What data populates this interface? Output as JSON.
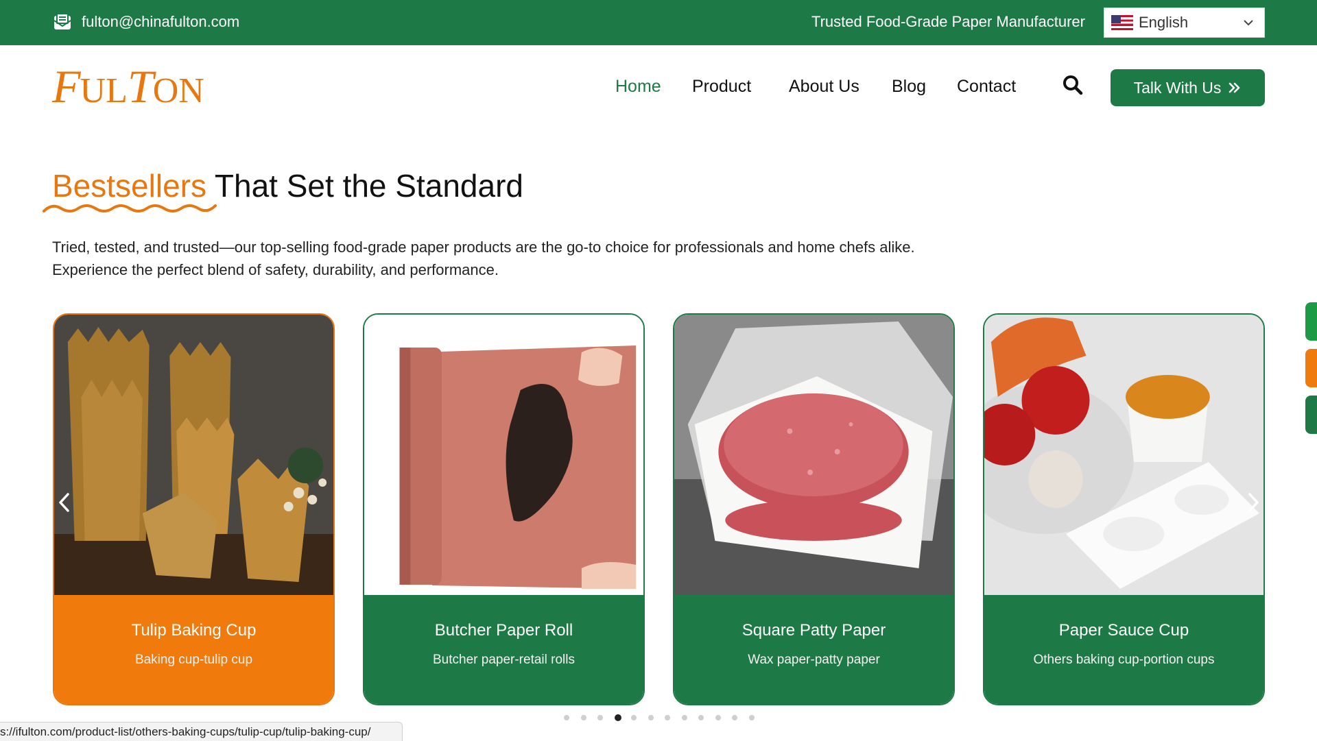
{
  "topbar": {
    "email": "fulton@chinafulton.com",
    "email_icon": "mail-icon",
    "tagline": "Trusted Food-Grade Paper Manufacturer",
    "language": "English",
    "language_flag": "us-flag-icon"
  },
  "header": {
    "logo_text": "FULTON",
    "nav": [
      {
        "label": "Home",
        "active": true
      },
      {
        "label": "Product",
        "active": false
      },
      {
        "label": "About Us",
        "active": false
      },
      {
        "label": "Blog",
        "active": false
      },
      {
        "label": "Contact",
        "active": false
      }
    ],
    "search_icon": "search-icon",
    "cta_label": "Talk With Us",
    "cta_icon": "double-chevron-right-icon"
  },
  "section": {
    "heading_accent": "Bestsellers",
    "heading_rest": "That Set the Standard",
    "intro": "Tried, tested, and trusted—our top-selling food-grade paper products are the go-to choice for professionals and home chefs alike. Experience the perfect blend of safety, durability, and performance."
  },
  "products": [
    {
      "title": "Tulip Baking Cup",
      "subtitle": "Baking cup-tulip cup",
      "highlighted": true
    },
    {
      "title": "Butcher Paper Roll",
      "subtitle": "Butcher paper-retail rolls",
      "highlighted": false
    },
    {
      "title": "Square Patty Paper",
      "subtitle": "Wax paper-patty paper",
      "highlighted": false
    },
    {
      "title": "Paper Sauce Cup",
      "subtitle": "Others baking cup-portion cups",
      "highlighted": false
    }
  ],
  "carousel": {
    "prev_icon": "chevron-left-icon",
    "next_icon": "chevron-right-icon",
    "dot_count": 12,
    "active_dot": 4
  },
  "status_url": "s://ifulton.com/product-list/others-baking-cups/tulip-cup/tulip-baking-cup/",
  "colors": {
    "brand_green": "#1d7a46",
    "brand_orange": "#e8770f"
  }
}
